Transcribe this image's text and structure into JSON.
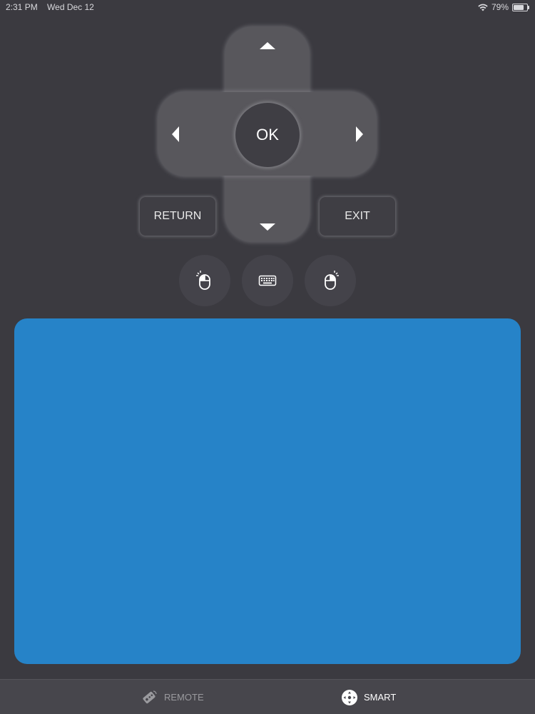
{
  "status_bar": {
    "time": "2:31 PM",
    "date": "Wed Dec 12",
    "battery": "79%",
    "battery_level": 0.79,
    "icons": [
      "wifi-icon",
      "battery-icon"
    ]
  },
  "dpad": {
    "ok_label": "OK",
    "icons": [
      "arrow-up-icon",
      "arrow-down-icon",
      "arrow-left-icon",
      "arrow-right-icon"
    ]
  },
  "buttons": {
    "return_label": "RETURN",
    "exit_label": "EXIT"
  },
  "mouse_controls": {
    "icons": [
      "mouse-left-click-icon",
      "keyboard-icon",
      "mouse-right-click-icon"
    ]
  },
  "tab_bar": {
    "tabs": [
      {
        "label": "REMOTE",
        "icon": "remote-icon",
        "active": false
      },
      {
        "label": "SMART",
        "icon": "smart-nav-icon",
        "active": true
      }
    ]
  },
  "colors": {
    "background": "#3b3a40",
    "dpad": "#58575c",
    "touchpad": "#2683c8",
    "tab_bar": "#47464c",
    "inactive_tab": "#9a9a9e",
    "active_tab": "#ffffff"
  }
}
